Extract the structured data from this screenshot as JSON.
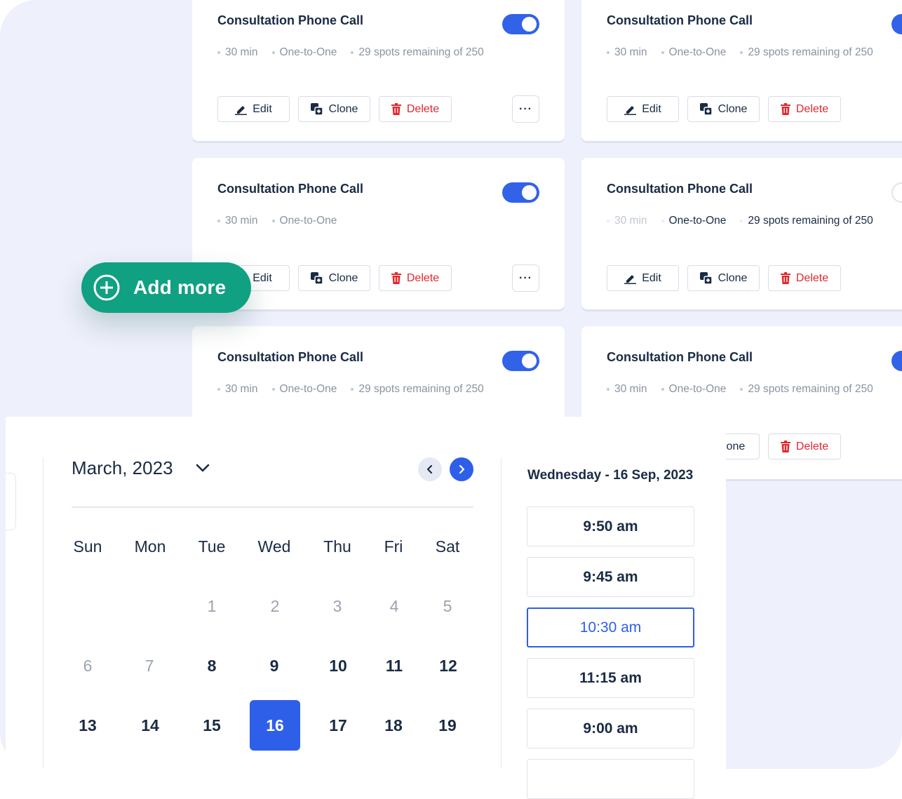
{
  "cards": [
    {
      "title": "Consultation Phone Call",
      "duration": "30 min",
      "type": "One-to-One",
      "spots": "29 spots remaining of 250",
      "enabled": true
    },
    {
      "title": "Consultation Phone Call",
      "duration": "30 min",
      "type": "One-to-One",
      "spots": "29 spots remaining of 250",
      "enabled": true
    },
    {
      "title": "Consultation Phone Call",
      "duration": "30 min",
      "type": "One-to-One",
      "spots": "",
      "enabled": true
    },
    {
      "title": "Consultation Phone Call",
      "duration": "30 min",
      "type": "One-to-One",
      "spots": "29 spots remaining of 250",
      "enabled": false
    },
    {
      "title": "Consultation Phone Call",
      "duration": "30 min",
      "type": "One-to-One",
      "spots": "29 spots remaining of 250",
      "enabled": true
    },
    {
      "title": "Consultation Phone Call",
      "duration": "30 min",
      "type": "One-to-One",
      "spots": "29 spots remaining of 250",
      "enabled": true
    }
  ],
  "actions": {
    "edit": "Edit",
    "clone": "Clone",
    "clone_partial": "lone",
    "delete": "Delete",
    "more": "···"
  },
  "add_more": {
    "label": "Add more"
  },
  "calendar": {
    "month": "March, 2023",
    "weekdays": [
      "Sun",
      "Mon",
      "Tue",
      "Wed",
      "Thu",
      "Fri",
      "Sat"
    ],
    "weeks": [
      [
        "",
        "",
        "1",
        "2",
        "3",
        "4",
        "5"
      ],
      [
        "6",
        "7",
        "8",
        "9",
        "10",
        "11",
        "12"
      ],
      [
        "13",
        "14",
        "15",
        "16",
        "17",
        "18",
        "19"
      ]
    ],
    "selected_day": "16"
  },
  "time_panel": {
    "date": "Wednesday - 16 Sep, 2023",
    "slots": [
      "9:50 am",
      "9:45 am",
      "10:30 am",
      "11:15 am",
      "9:00 am"
    ],
    "selected_slot": "10:30 am"
  },
  "colors": {
    "primary": "#2e5fe9",
    "accent_green": "#10a082",
    "danger": "#e0282e",
    "background": "#eef0fb"
  }
}
